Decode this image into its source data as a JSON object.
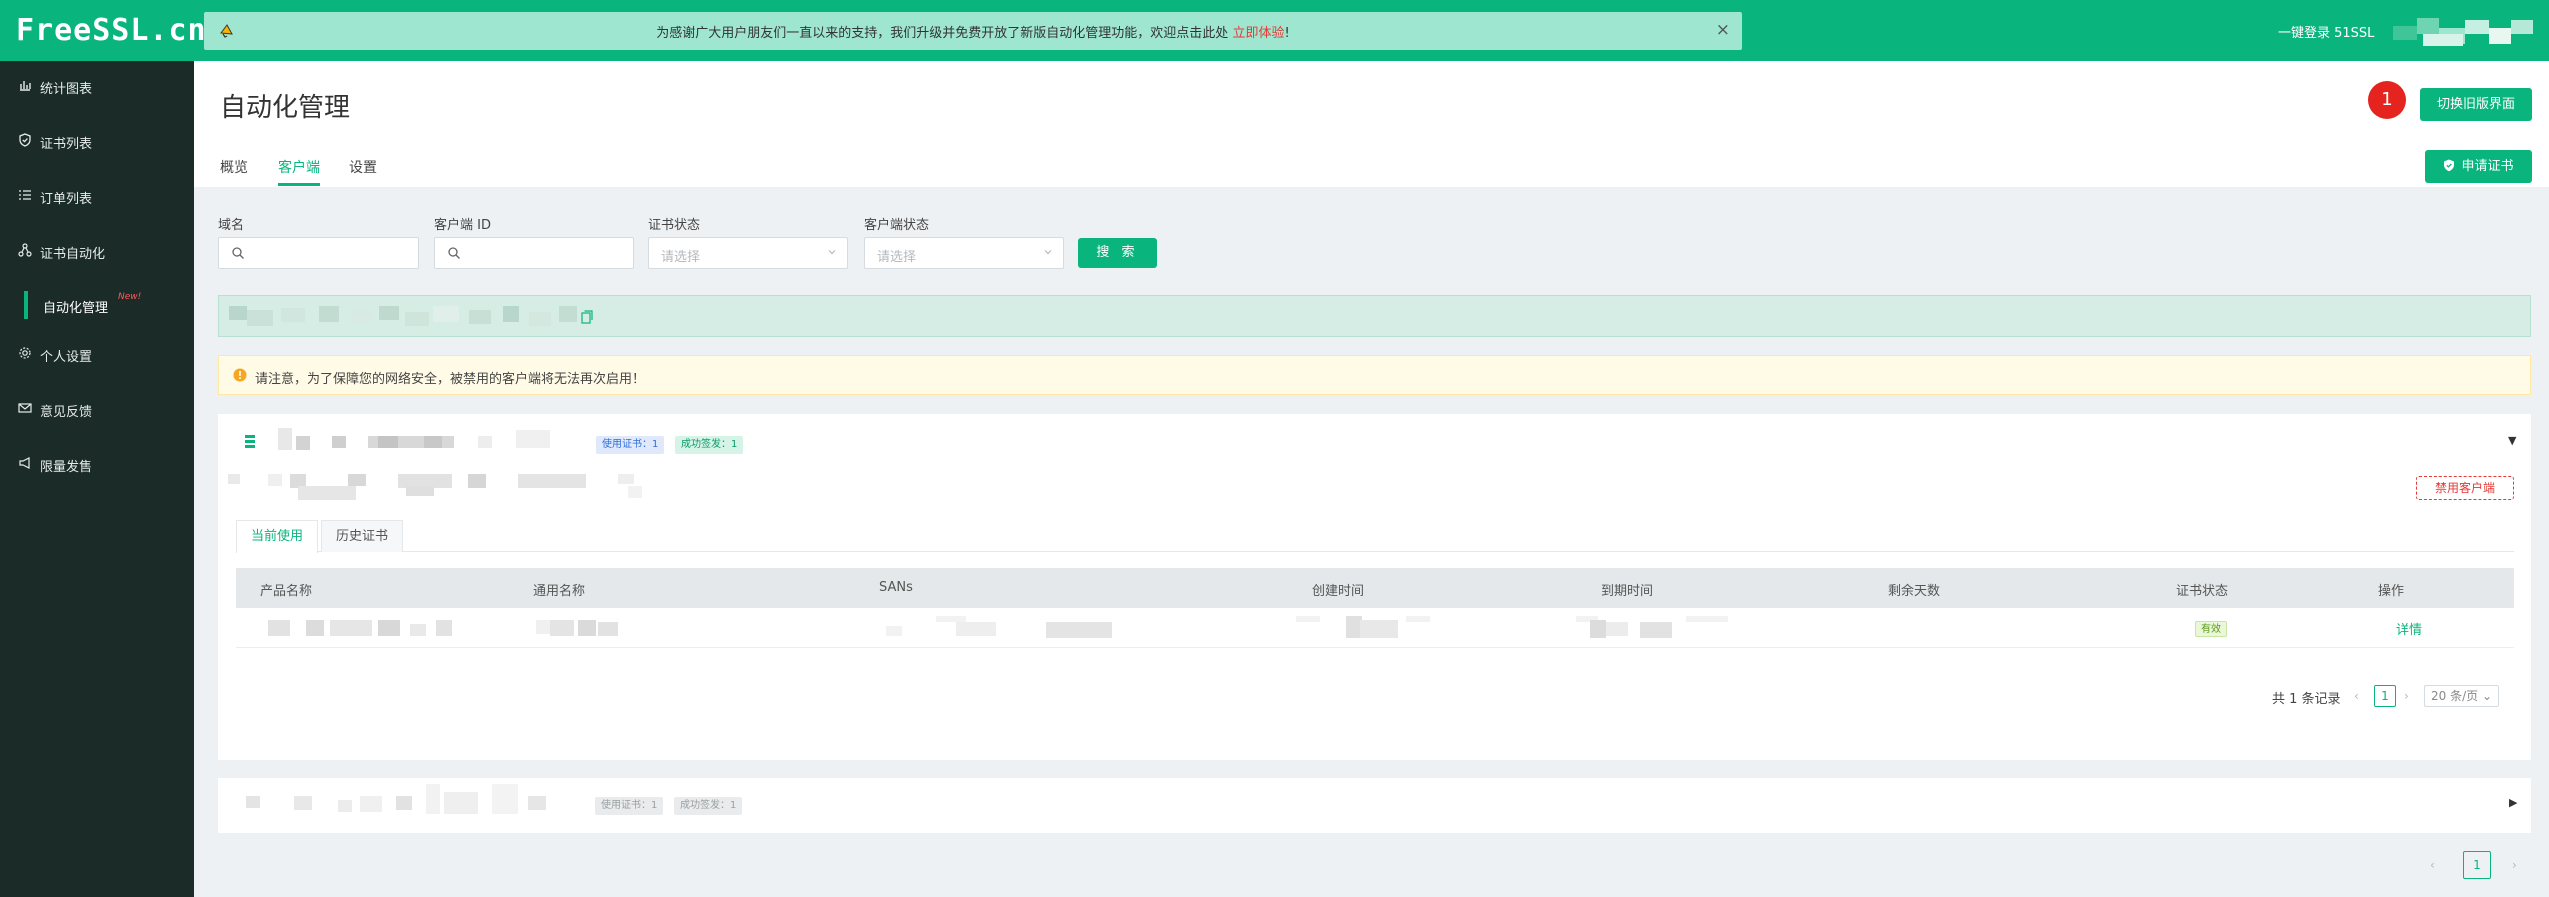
{
  "brand": {
    "logo": "FreeSSL.cn",
    "accent": "#0ab47d"
  },
  "notice": {
    "text": "为感谢广大用户朋友们一直以来的支持，我们升级并免费开放了新版自动化管理功能，欢迎点击此处",
    "link": "立即体验",
    "suffix": "!",
    "close": "×"
  },
  "topbar": {
    "login_link": "一键登录 51SSL"
  },
  "sidebar": {
    "items": [
      {
        "label": "统计图表",
        "icon": "bar-chart-icon"
      },
      {
        "label": "证书列表",
        "icon": "shield-check-icon"
      },
      {
        "label": "订单列表",
        "icon": "list-icon"
      },
      {
        "label": "证书自动化",
        "icon": "network-icon"
      },
      {
        "label": "个人设置",
        "icon": "gear-icon"
      },
      {
        "label": "意见反馈",
        "icon": "mail-icon"
      },
      {
        "label": "限量发售",
        "icon": "megaphone-icon"
      }
    ],
    "sub_item": {
      "label": "自动化管理",
      "badge": "New!"
    }
  },
  "header": {
    "title": "自动化管理",
    "tabs": [
      {
        "label": "概览"
      },
      {
        "label": "客户端",
        "active": true
      },
      {
        "label": "设置"
      }
    ],
    "badge": "1",
    "switch_button": "切换旧版界面",
    "apply_button": "申请证书"
  },
  "filters": {
    "domain_label": "域名",
    "client_id_label": "客户端 ID",
    "cert_status_label": "证书状态",
    "cert_status_placeholder": "请选择",
    "client_status_label": "客户端状态",
    "client_status_placeholder": "请选择",
    "search_button": "搜 索"
  },
  "warning": {
    "text": "请注意，为了保障您的网络安全，被禁用的客户端将无法再次启用！"
  },
  "client_card": {
    "tag_used": "使用证书：1",
    "tag_issued": "成功签发：1",
    "disable_button": "禁用客户端",
    "subtabs": [
      {
        "label": "当前使用",
        "active": true
      },
      {
        "label": "历史证书"
      }
    ],
    "table": {
      "headers": [
        "产品名称",
        "通用名称",
        "SANs",
        "创建时间",
        "到期时间",
        "剩余天数",
        "证书状态",
        "操作"
      ],
      "rows": [
        {
          "status": "有效",
          "action": "详情"
        }
      ]
    },
    "pagination": {
      "total": "共 1 条记录",
      "page": "1",
      "page_size": "20 条/页"
    }
  },
  "client_card_2": {
    "tag_used": "使用证书：1",
    "tag_issued": "成功签发：1"
  },
  "page_pagination": {
    "page": "1"
  }
}
